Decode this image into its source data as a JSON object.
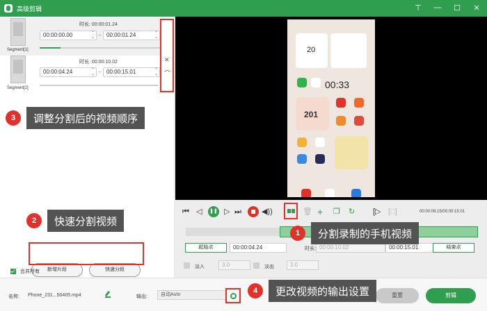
{
  "window": {
    "title": "高级剪辑"
  },
  "segments": [
    {
      "label": "Segment[1]",
      "duration_label": "时长: 00:00:01.24",
      "start": "00:00:00.00",
      "end": "00:00:01.24"
    },
    {
      "label": "Segment[2]",
      "duration_label": "时长: 00:00:10.02",
      "start": "00:00:04.24",
      "end": "00:00:15.01"
    }
  ],
  "callouts": [
    {
      "num": "1",
      "text": "分割录制的手机视频"
    },
    {
      "num": "2",
      "text": "快速分割视频"
    },
    {
      "num": "3",
      "text": "调整分割后的视频顺序"
    },
    {
      "num": "4",
      "text": "更改视频的输出设置"
    }
  ],
  "left": {
    "add_segment": "新增片段",
    "quick_split": "快速分段",
    "merge_all": "合并所有"
  },
  "phone": {
    "clock_time": "20",
    "big_time": "00:33",
    "steps": "201"
  },
  "player": {
    "time_readout": "00:00:09.15/00:00:15.01"
  },
  "trim": {
    "start_btn": "起始点",
    "start_val": "00:00:04.24",
    "duration_label": "时长:",
    "duration_val": "00:00:10.02",
    "end_val": "00:00:15.01",
    "end_btn": "结束点",
    "fade_in": "淡入",
    "fade_in_val": "3.0",
    "fade_out": "淡出",
    "fade_out_val": "3.0"
  },
  "bottom": {
    "name_label": "名称:",
    "name_val": "Phone_231...50405.mp4",
    "output_label": "输出:",
    "output_val": "自动Auto",
    "reset": "重置",
    "export": "剪辑"
  },
  "colors": {
    "accent": "#2f9e4f",
    "highlight": "#e0312b",
    "callout_bg": "#535353"
  }
}
